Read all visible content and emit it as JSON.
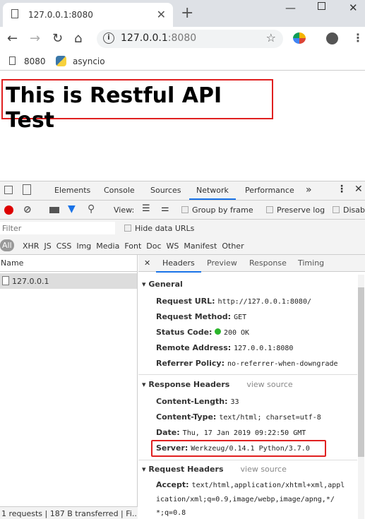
{
  "browser": {
    "tab_title": "127.0.0.1:8080",
    "url_host": "127.0.0.1",
    "url_port": ":8080",
    "bookmarks": [
      {
        "label": "8080",
        "icon": "page-icon"
      },
      {
        "label": "asyncio",
        "icon": "python-icon"
      }
    ]
  },
  "page": {
    "heading": "This is Restful API Test",
    "highlight_color": "#e02020"
  },
  "devtools": {
    "tabs": [
      "Elements",
      "Console",
      "Sources",
      "Network",
      "Performance"
    ],
    "active_tab": "Network",
    "more": "»",
    "toolbar": {
      "view_label": "View:",
      "group_by_frame": "Group by frame",
      "preserve_log": "Preserve log",
      "disable_cache": "Disab"
    },
    "filter_placeholder": "Filter",
    "hide_data_urls": "Hide data URLs",
    "types": [
      "All",
      "XHR",
      "JS",
      "CSS",
      "Img",
      "Media",
      "Font",
      "Doc",
      "WS",
      "Manifest",
      "Other"
    ],
    "name_header": "Name",
    "requests": [
      "127.0.0.1"
    ],
    "detail_tabs": [
      "Headers",
      "Preview",
      "Response",
      "Timing"
    ],
    "general": {
      "title": "General",
      "items": [
        {
          "k": "Request URL:",
          "v": "http://127.0.0.1:8080/"
        },
        {
          "k": "Request Method:",
          "v": "GET"
        },
        {
          "k": "Status Code:",
          "v": "200 OK"
        },
        {
          "k": "Remote Address:",
          "v": "127.0.0.1:8080"
        },
        {
          "k": "Referrer Policy:",
          "v": "no-referrer-when-downgrade"
        }
      ]
    },
    "response_headers": {
      "title": "Response Headers",
      "view_source": "view source",
      "items": [
        {
          "k": "Content-Length:",
          "v": "33"
        },
        {
          "k": "Content-Type:",
          "v": "text/html; charset=utf-8"
        },
        {
          "k": "Date:",
          "v": "Thu, 17 Jan 2019 09:22:50 GMT"
        },
        {
          "k": "Server:",
          "v": "Werkzeug/0.14.1 Python/3.7.0"
        }
      ]
    },
    "request_headers": {
      "title": "Request Headers",
      "view_source": "view source",
      "accept_key": "Accept:",
      "accept_lines": [
        "text/html,application/xhtml+xml,appl",
        "ication/xml;q=0.9,image/webp,image/apng,*/",
        "*;q=0.8"
      ]
    },
    "status_bar": "1 requests | 187 B transferred | Fi...",
    "status_ok_color": "#2bb52b"
  }
}
